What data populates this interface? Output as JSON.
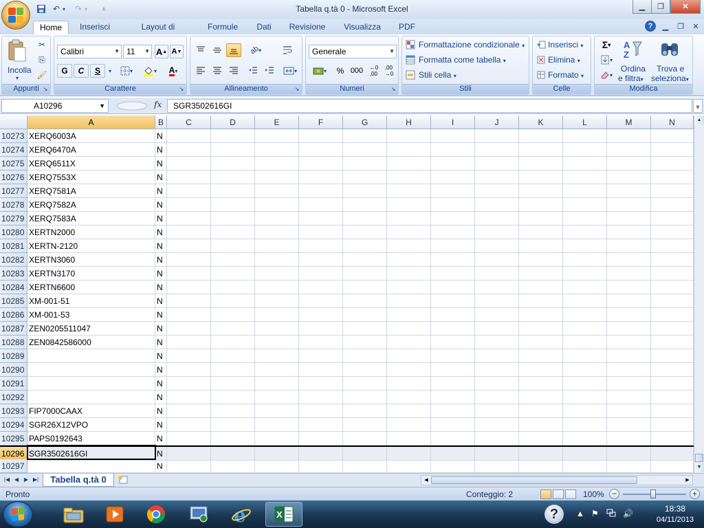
{
  "window": {
    "title": "Tabella q.tà 0 - Microsoft Excel"
  },
  "ribbon": {
    "tabs": [
      "Home",
      "Inserisci",
      "Layout di pagina",
      "Formule",
      "Dati",
      "Revisione",
      "Visualizza",
      "PDF"
    ],
    "active_tab": "Home",
    "groups": {
      "appunti": {
        "label": "Appunti",
        "paste_label": "Incolla"
      },
      "carattere": {
        "label": "Carattere",
        "font_name": "Calibri",
        "font_size": "11",
        "bold": "G",
        "italic": "C",
        "underline": "S"
      },
      "allineamento": {
        "label": "Allineamento"
      },
      "numeri": {
        "label": "Numeri",
        "number_format": "Generale",
        "percent": "%",
        "thousands": "000"
      },
      "stili": {
        "label": "Stili",
        "conditional": "Formattazione condizionale",
        "format_table": "Formatta come tabella",
        "cell_styles": "Stili cella"
      },
      "celle": {
        "label": "Celle",
        "insert": "Inserisci",
        "delete": "Elimina",
        "format": "Formato"
      },
      "modifica": {
        "label": "Modifica",
        "sort_line1": "Ordina",
        "sort_line2": "e filtra",
        "find_line1": "Trova e",
        "find_line2": "seleziona",
        "sigma": "Σ"
      }
    }
  },
  "formula_bar": {
    "name_box": "A10296",
    "fx": "fx",
    "content": "SGR3502616GI"
  },
  "sheet": {
    "columns": [
      "A",
      "B",
      "C",
      "D",
      "E",
      "F",
      "G",
      "H",
      "I",
      "J",
      "K",
      "L",
      "M",
      "N"
    ],
    "rows": [
      {
        "num": "10273",
        "a": "XERQ6003A",
        "b": "N"
      },
      {
        "num": "10274",
        "a": "XERQ6470A",
        "b": "N"
      },
      {
        "num": "10275",
        "a": "XERQ6511X",
        "b": "N"
      },
      {
        "num": "10276",
        "a": "XERQ7553X",
        "b": "N"
      },
      {
        "num": "10277",
        "a": "XERQ7581A",
        "b": "N"
      },
      {
        "num": "10278",
        "a": "XERQ7582A",
        "b": "N"
      },
      {
        "num": "10279",
        "a": "XERQ7583A",
        "b": "N"
      },
      {
        "num": "10280",
        "a": "XERTN2000",
        "b": "N"
      },
      {
        "num": "10281",
        "a": "XERTN-2120",
        "b": "N"
      },
      {
        "num": "10282",
        "a": "XERTN3060",
        "b": "N"
      },
      {
        "num": "10283",
        "a": "XERTN3170",
        "b": "N"
      },
      {
        "num": "10284",
        "a": "XERTN6600",
        "b": "N"
      },
      {
        "num": "10285",
        "a": "XM-001-51",
        "b": "N"
      },
      {
        "num": "10286",
        "a": "XM-001-53",
        "b": "N"
      },
      {
        "num": "10287",
        "a": "ZEN0205511047",
        "b": "N"
      },
      {
        "num": "10288",
        "a": "ZEN0842586000",
        "b": "N"
      },
      {
        "num": "10289",
        "a": "",
        "b": "N"
      },
      {
        "num": "10290",
        "a": "",
        "b": "N"
      },
      {
        "num": "10291",
        "a": "",
        "b": "N"
      },
      {
        "num": "10292",
        "a": "",
        "b": "N"
      },
      {
        "num": "10293",
        "a": "FIP7000CAAX",
        "b": "N"
      },
      {
        "num": "10294",
        "a": "SGR26X12VPO",
        "b": "N"
      },
      {
        "num": "10295",
        "a": "PAPS0192643",
        "b": "N"
      },
      {
        "num": "10296",
        "a": "SGR3502616GI",
        "b": "N",
        "selected": true
      },
      {
        "num": "10297",
        "a": "",
        "b": "N"
      }
    ],
    "sheet_tab": "Tabella q.tà 0"
  },
  "status_bar": {
    "ready": "Pronto",
    "count": "Conteggio: 2",
    "zoom": "100%"
  },
  "taskbar": {
    "time": "18:38",
    "date": "04/11/2013"
  }
}
